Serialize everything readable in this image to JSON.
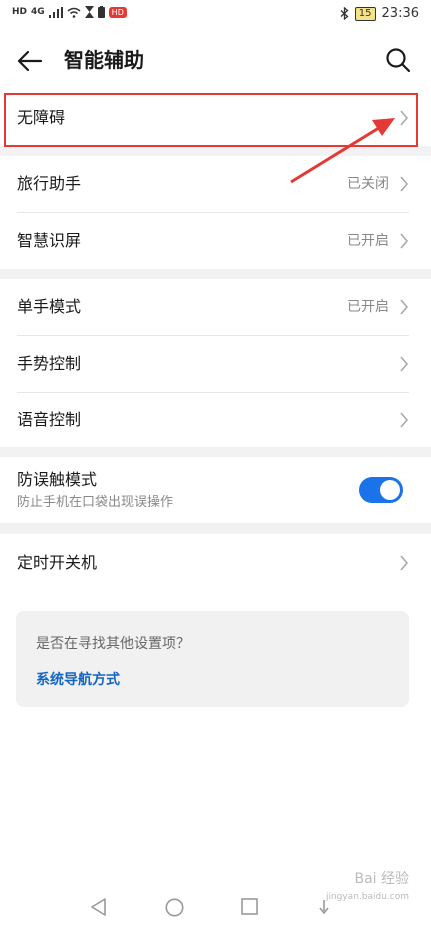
{
  "status_bar": {
    "left_indicators": [
      "HD",
      "4G",
      "HD"
    ],
    "time": "23:36",
    "battery": "15"
  },
  "header": {
    "title": "智能辅助"
  },
  "rows": [
    {
      "label": "无障碍",
      "status": ""
    },
    {
      "label": "旅行助手",
      "status": "已关闭"
    },
    {
      "label": "智慧识屏",
      "status": "已开启"
    },
    {
      "label": "单手模式",
      "status": "已开启"
    },
    {
      "label": "手势控制",
      "status": ""
    },
    {
      "label": "语音控制",
      "status": ""
    },
    {
      "label": "定时开关机",
      "status": ""
    }
  ],
  "toggle_row": {
    "label": "防误触模式",
    "sublabel": "防止手机在口袋出现误操作",
    "enabled": true
  },
  "suggestion_card": {
    "question": "是否在寻找其他设置项？",
    "link": "系统导航方式"
  },
  "watermark": {
    "main": "Bai 经验",
    "sub": "jingyan.baidu.com"
  },
  "colors": {
    "accent": "#1a73e8",
    "link": "#1565c0",
    "annotation": "#e53935",
    "section_gap": "#f2f2f2"
  }
}
